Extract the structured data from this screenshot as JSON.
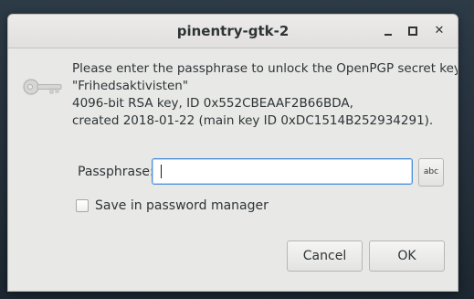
{
  "window": {
    "title": "pinentry-gtk-2"
  },
  "dialog": {
    "message_line1": "Please enter the passphrase to unlock the OpenPGP secret key:",
    "message_line2": "\"Frihedsaktivisten\"",
    "message_line3": "4096-bit RSA key, ID 0x552CBEAAF2B66BDA,",
    "message_line4": "created 2018-01-22 (main key ID 0xDC1514B252934291).",
    "passphrase_label": "Passphrase:",
    "passphrase_value": "",
    "abc_button_label": "abc",
    "save_checkbox_label": "Save in password manager",
    "save_checked": false,
    "cancel_label": "Cancel",
    "ok_label": "OK"
  },
  "icons": {
    "dialog_icon": "key-icon",
    "minimize": "minimize-icon",
    "maximize": "maximize-icon",
    "close": "close-icon"
  }
}
